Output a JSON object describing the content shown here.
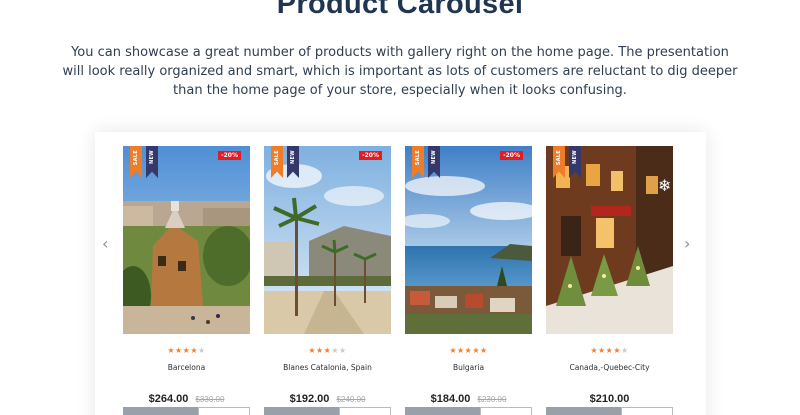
{
  "page": {
    "title": "Product Carousel",
    "description": "You can showcase a great number of products with gallery right on the home page. The presentation will look really organized and smart, which is important as lots of customers are reluctant to dig deeper than the home page of your store, especially when it looks confusing."
  },
  "carousel": {
    "prev_icon": "chevron-left-icon",
    "next_icon": "chevron-right-icon",
    "arrow_prev": "‹",
    "arrow_next": "›",
    "ribbon_sale": "SALE",
    "ribbon_new": "NEW",
    "products": [
      {
        "name": "Barcelona",
        "price": "$264.00",
        "old_price": "$330.00",
        "discount": "-20%",
        "rating": 4,
        "max_rating": 5
      },
      {
        "name": "Blanes Catalonia, Spain",
        "price": "$192.00",
        "old_price": "$240.00",
        "discount": "-20%",
        "rating": 3,
        "max_rating": 5
      },
      {
        "name": "Bulgaria",
        "price": "$184.00",
        "old_price": "$230.00",
        "discount": "-20%",
        "rating": 5,
        "max_rating": 5
      },
      {
        "name": "Canada,-Quebec-City",
        "price": "$210.00",
        "old_price": "",
        "discount": "",
        "rating": 4,
        "max_rating": 5
      }
    ]
  },
  "colors": {
    "title": "#1f3552",
    "sale_ribbon": "#ef7c28",
    "new_ribbon": "#34386a",
    "discount_badge": "#e21c23",
    "star_on": "#f0812e",
    "star_off": "#c9ccd1"
  }
}
